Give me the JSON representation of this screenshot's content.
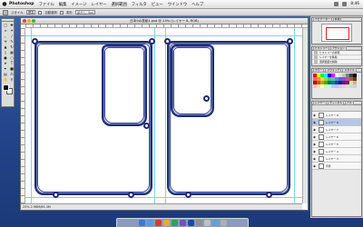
{
  "menubar": {
    "apple": "",
    "app": "Photoshop",
    "items": [
      "ファイル",
      "編集",
      "イメージ",
      "レイヤー",
      "選択範囲",
      "フィルタ",
      "ビュー",
      "ウインドウ",
      "ヘルプ"
    ],
    "clock": "8:46"
  },
  "optionsbar": {
    "labels": [
      "スタイル",
      "自動選択",
      "変形"
    ],
    "fields": [
      "標準",
      "ぼかし: 0px"
    ]
  },
  "document": {
    "title": "日本9の表紙1.psd @ 25% (レイヤー 8, RGB)",
    "status": "25% 2.96M/65.3M",
    "colors": {
      "frame": "#1f2c6e",
      "guide": "#7fd4e6"
    }
  },
  "panels": {
    "navigator": {
      "tabs": [
        "ナビゲーター",
        "情報"
      ]
    },
    "history": {
      "tabs": [
        "ヒストリー",
        "アクション"
      ],
      "rows": [
        "ヒストリーの状態",
        "レイヤーを移動",
        "選択範囲を解除"
      ]
    },
    "swatches": {
      "tabs": [
        "カラー",
        "スウォッチ",
        "スタイル"
      ]
    },
    "layers": {
      "tabs": [
        "レイヤー",
        "チャンネル",
        "パス"
      ],
      "rows": [
        "レイヤー 9",
        "レイヤー 8",
        "レイヤー 7",
        "レイヤー 6",
        "レイヤー 5",
        "レイヤー 4",
        "レイヤー 3",
        "背景"
      ]
    }
  }
}
